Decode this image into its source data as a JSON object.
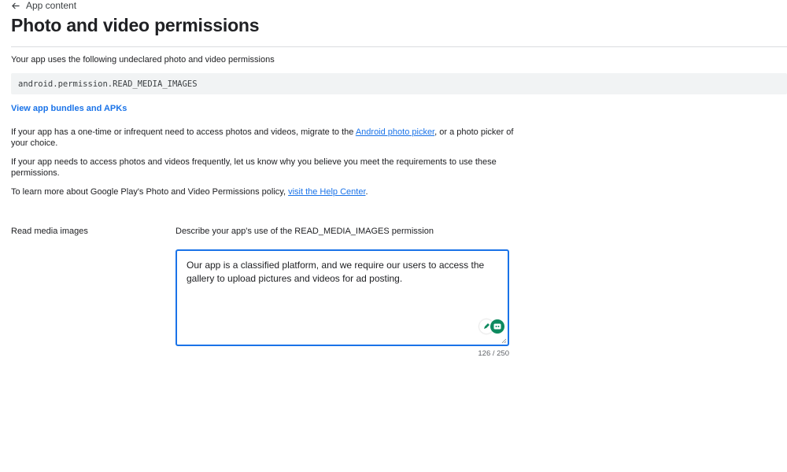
{
  "header": {
    "back_label": "App content",
    "title": "Photo and video permissions"
  },
  "intro": {
    "text": "Your app uses the following undeclared photo and video permissions",
    "permission": "android.permission.READ_MEDIA_IMAGES"
  },
  "links": {
    "bundles": "View app bundles and APKs"
  },
  "paragraphs": {
    "p1_before": "If your app has a one-time or infrequent need to access photos and videos, migrate to the ",
    "p1_link": "Android photo picker",
    "p1_after": ", or a photo picker of your choice.",
    "p2": "If your app needs to access photos and videos frequently, let us know why you believe you meet the requirements to use these permissions.",
    "p3_before": "To learn more about Google Play's Photo and Video Permissions policy, ",
    "p3_link": "visit the Help Center",
    "p3_after": "."
  },
  "form": {
    "row_label": "Read media images",
    "field_label": "Describe your app's use of the READ_MEDIA_IMAGES permission",
    "value": "Our app is a classified platform, and we require our users to access the gallery to upload pictures and videos for ad posting.",
    "char_count": "126 / 250"
  },
  "icons": {
    "back": "arrow-left-icon",
    "pencil": "pencil-icon",
    "assistant": "grammar-assistant-icon"
  },
  "colors": {
    "accent": "#1a73e8",
    "assistant": "#0e8a5f"
  }
}
